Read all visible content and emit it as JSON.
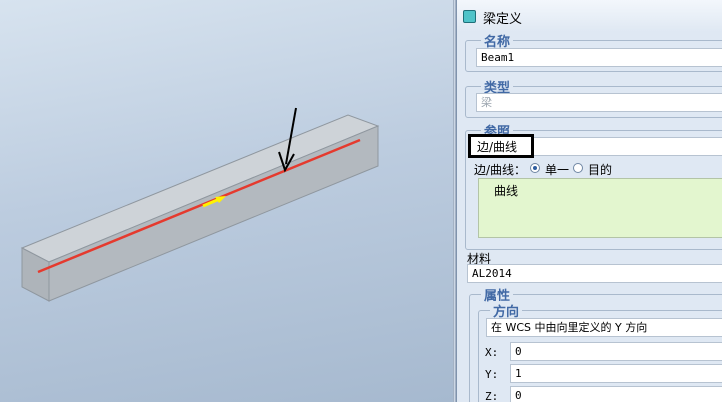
{
  "dialog": {
    "title": "梁定义",
    "name_group": {
      "legend": "名称",
      "value": "Beam1"
    },
    "type_group": {
      "legend": "类型",
      "value": "梁"
    },
    "reference_group": {
      "legend": "参照",
      "selected_reference": "边/曲线",
      "mode_label": "边/曲线：",
      "options": [
        "单一",
        "目的"
      ],
      "selected_option": "单一",
      "list_items": [
        "曲线"
      ]
    },
    "material": {
      "label": "材料",
      "value": "AL2014"
    },
    "properties": {
      "legend": "属性",
      "orientation": {
        "legend": "方向",
        "value": "在 WCS 中由向里定义的 Y 方向"
      },
      "x": {
        "label": "X:",
        "value": "0"
      },
      "y": {
        "label": "Y:",
        "value": "1"
      },
      "z": {
        "label": "Z:",
        "value": "0"
      }
    }
  },
  "viewport": {
    "model": "beam-solid",
    "beam_curve_color": "#e53a2e",
    "direction_arrow_color": "#ffee33",
    "annotation_arrow_color": "#000000"
  }
}
